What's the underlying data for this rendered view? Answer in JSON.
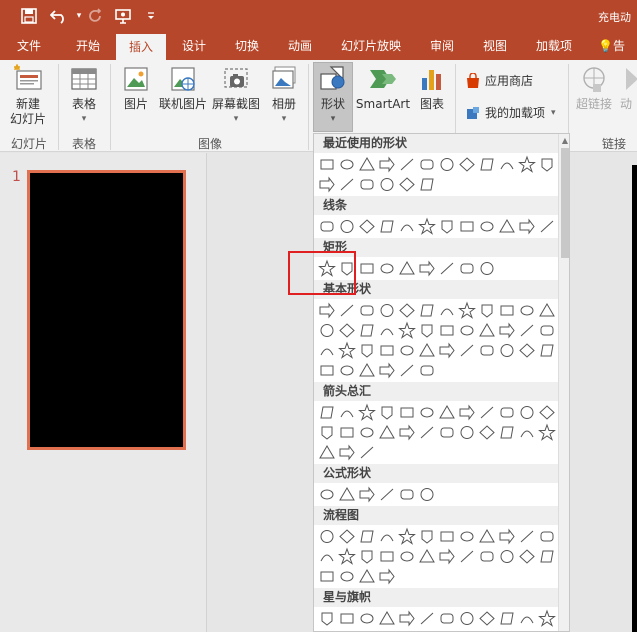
{
  "title_bar": {
    "doc_title": "充电动"
  },
  "quick_access": [
    "save-icon",
    "undo-icon",
    "redo-icon",
    "present-icon",
    "customize-icon"
  ],
  "tabs": [
    {
      "label": "文件"
    },
    {
      "label": "开始"
    },
    {
      "label": "插入",
      "active": true
    },
    {
      "label": "设计"
    },
    {
      "label": "切换"
    },
    {
      "label": "动画"
    },
    {
      "label": "幻灯片放映"
    },
    {
      "label": "审阅"
    },
    {
      "label": "视图"
    },
    {
      "label": "加载项"
    },
    {
      "label": "告"
    }
  ],
  "ribbon": {
    "new_slide": "新建\n幻灯片",
    "new_slide_line1": "新建",
    "new_slide_line2": "幻灯片",
    "group_slides": "幻灯片",
    "table": "表格",
    "group_table": "表格",
    "picture": "图片",
    "online_picture": "联机图片",
    "screenshot": "屏幕截图",
    "album": "相册",
    "group_images": "图像",
    "shapes": "形状",
    "smartart": "SmartArt",
    "chart": "图表",
    "app_store": "应用商店",
    "my_addins": "我的加载项",
    "hyperlink": "超链接",
    "action": "动",
    "group_links": "链接"
  },
  "slides": [
    {
      "number": "1"
    }
  ],
  "gallery": {
    "sections": [
      {
        "title": "最近使用的形状",
        "count_rows": [
          12,
          6
        ]
      },
      {
        "title": "线条",
        "count_rows": [
          12
        ]
      },
      {
        "title": "矩形",
        "count_rows": [
          9
        ]
      },
      {
        "title": "基本形状",
        "count_rows": [
          12,
          12,
          12,
          6
        ]
      },
      {
        "title": "箭头总汇",
        "count_rows": [
          12,
          12,
          3
        ]
      },
      {
        "title": "公式形状",
        "count_rows": [
          6
        ]
      },
      {
        "title": "流程图",
        "count_rows": [
          12,
          12,
          4
        ]
      },
      {
        "title": "星与旗帜",
        "count_rows": [
          12
        ]
      }
    ]
  }
}
